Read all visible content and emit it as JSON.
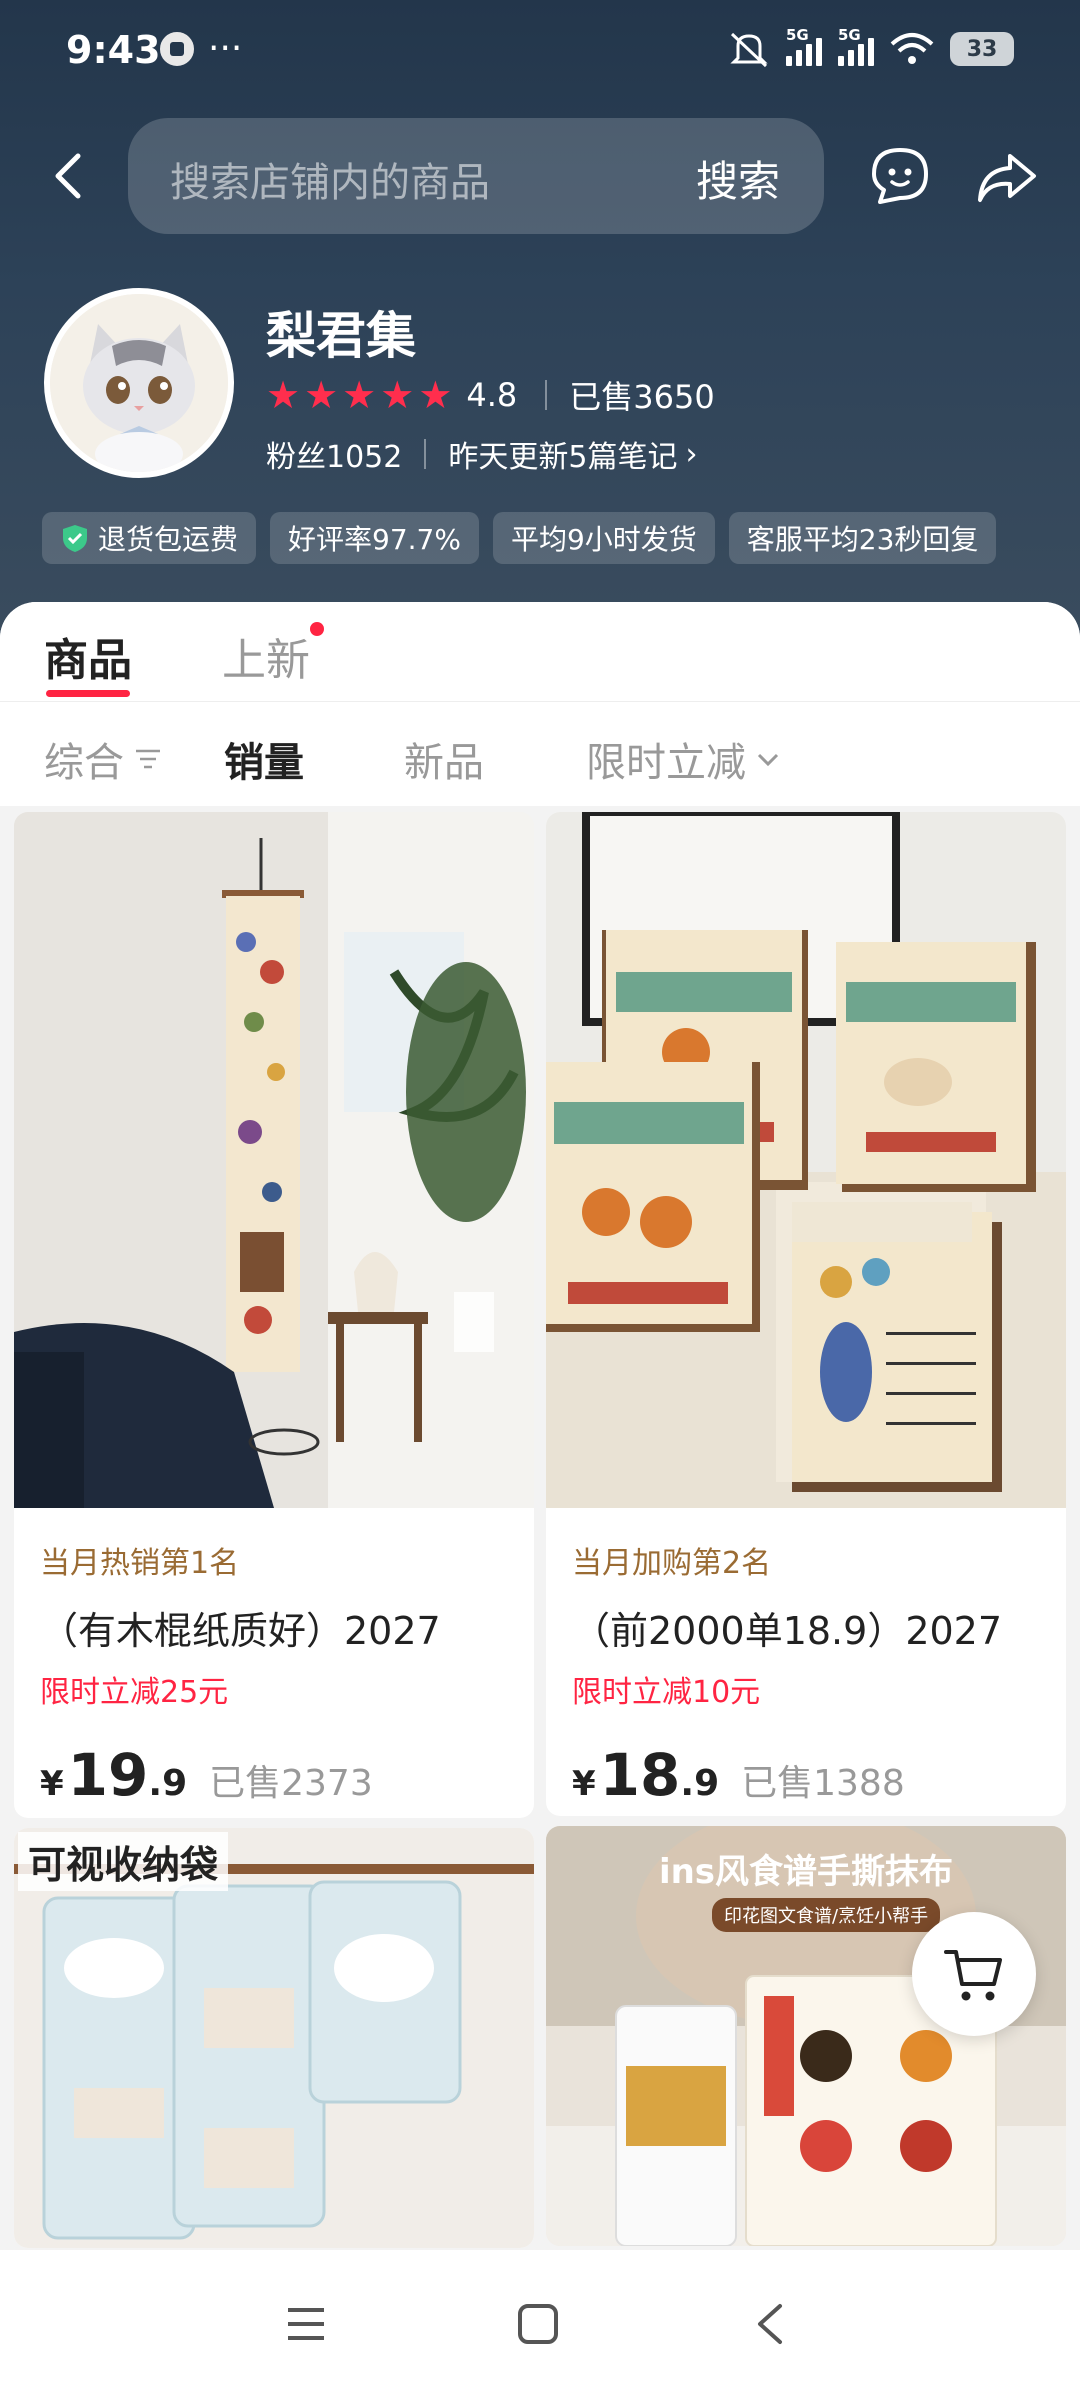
{
  "status_bar": {
    "time": "9:43",
    "more": "···",
    "network_1": "5G",
    "network_2": "5G",
    "battery": "33"
  },
  "search": {
    "placeholder": "搜索店铺内的商品",
    "button": "搜索"
  },
  "shop": {
    "name": "梨君集",
    "rating": "4.8",
    "sold": "已售3650",
    "fans": "粉丝1052",
    "updates": "昨天更新5篇笔记"
  },
  "service_tags": [
    "退货包运费",
    "好评率97.7%",
    "平均9小时发货",
    "客服平均23秒回复"
  ],
  "tabs": {
    "products": "商品",
    "new": "上新"
  },
  "filters": {
    "all": "综合",
    "sales": "销量",
    "new": "新品",
    "discount": "限时立减"
  },
  "products": [
    {
      "rank": "当月热销第1名",
      "title": "（有木棍纸质好）2027",
      "promo": "限时立减25元",
      "currency": "¥",
      "price_int": "19",
      "price_dec": ".9",
      "sold": "已售2373"
    },
    {
      "rank": "当月加购第2名",
      "title": "（前2000单18.9）2027",
      "promo": "限时立减10元",
      "currency": "¥",
      "price_int": "18",
      "price_dec": ".9",
      "sold": "已售1388"
    }
  ],
  "product_overlays": {
    "card3_label": "可视收纳袋",
    "card4_title": "ins风食谱手撕抹布",
    "card4_sub": "印花图文食谱/烹饪小帮手"
  },
  "colors": {
    "accent": "#ff2442",
    "header": "#2d4258",
    "rank": "#9a6b33"
  }
}
